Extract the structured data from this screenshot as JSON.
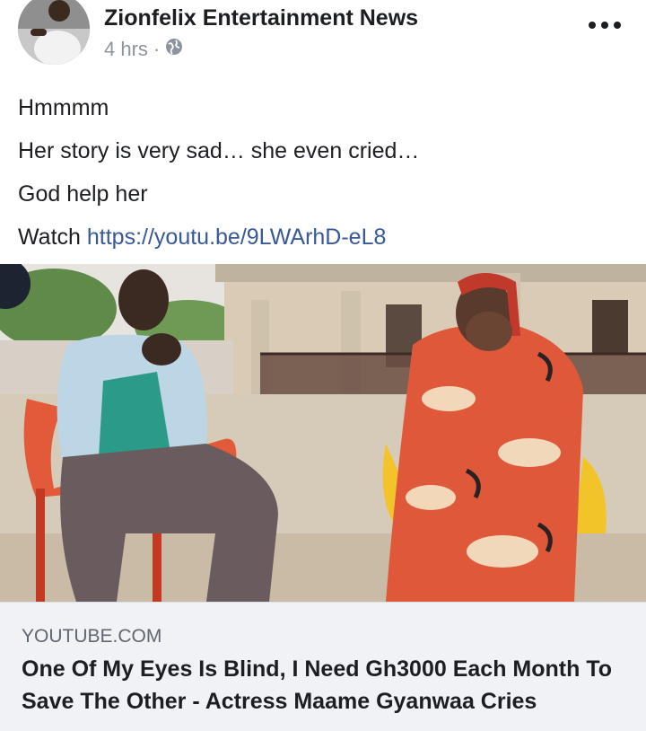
{
  "header": {
    "page_name": "Zionfelix Entertainment News",
    "time": "4 hrs",
    "separator": "·",
    "audience_icon": "globe-icon",
    "more_icon": "more-horizontal-icon"
  },
  "post": {
    "lines": [
      "Hmmmm",
      "Her story is very sad… she even cried…",
      "God help her"
    ],
    "watch_prefix": "Watch",
    "link": "https://youtu.be/9LWArhD-eL8"
  },
  "link_preview": {
    "thumbnail": "video-thumbnail-image",
    "domain": "YOUTUBE.COM",
    "title": "One Of My Eyes Is Blind, I Need Gh3000 Each Month To Save The Other - Actress Maame Gyanwaa Cries"
  },
  "colors": {
    "link": "#385898",
    "meta": "#8d949e",
    "preview_bg": "#f0f2f5",
    "text": "#1c1e21"
  }
}
